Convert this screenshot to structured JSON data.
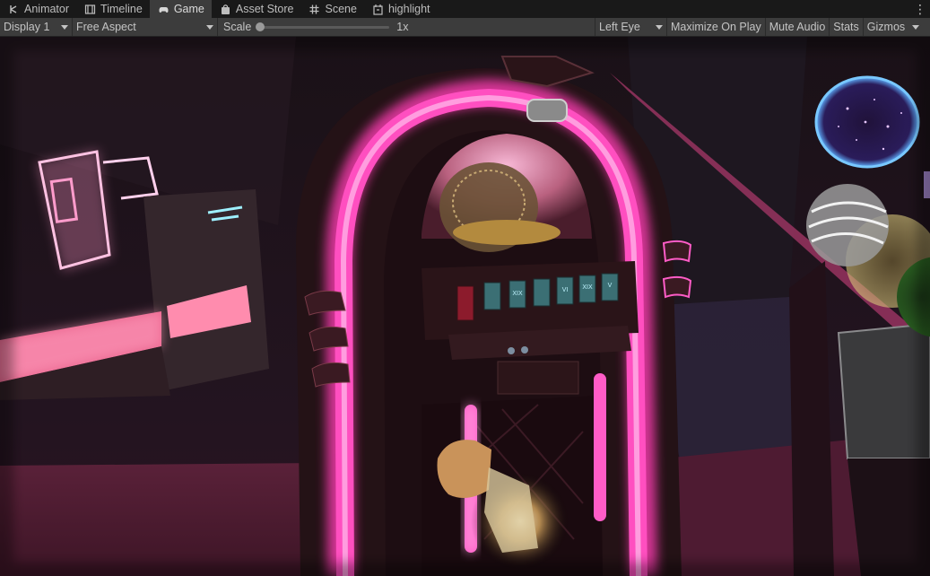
{
  "tabs": [
    {
      "label": "Animator",
      "icon": "animator-icon",
      "active": false
    },
    {
      "label": "Timeline",
      "icon": "timeline-icon",
      "active": false
    },
    {
      "label": "Game",
      "icon": "gamepad-icon",
      "active": true
    },
    {
      "label": "Asset Store",
      "icon": "shopping-bag-icon",
      "active": false
    },
    {
      "label": "Scene",
      "icon": "hash-grid-icon",
      "active": false
    },
    {
      "label": "highlight",
      "icon": "custom-window-icon",
      "active": false
    }
  ],
  "toolbar": {
    "display": "Display 1",
    "aspect": "Free Aspect",
    "scale_label": "Scale",
    "scale_value": "1x",
    "scale_fraction": 0.0,
    "eye": "Left Eye",
    "maximize": "Maximize On Play",
    "mute": "Mute Audio",
    "stats": "Stats",
    "gizmos": "Gizmos"
  },
  "scene": {
    "selector_labels": [
      "XIX",
      "VI",
      "XIX",
      "V"
    ],
    "colors": {
      "neon_pink": "#ff3db4",
      "neon_glow": "#ff8fd8",
      "cyan": "#7fe6ff",
      "floor": "#4a1a2e",
      "backdrop": "#1a0f18"
    }
  }
}
